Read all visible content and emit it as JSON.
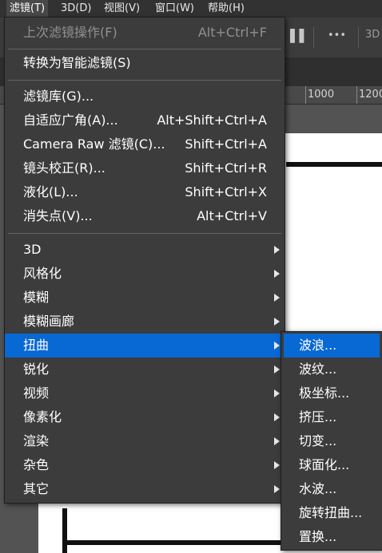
{
  "menubar": {
    "items": [
      {
        "label": "滤镜(T)",
        "active": true
      },
      {
        "label": "3D(D)"
      },
      {
        "label": "视图(V)"
      },
      {
        "label": "窗口(W)"
      },
      {
        "label": "帮助(H)"
      }
    ]
  },
  "options_bar": {
    "more_label": "•••",
    "label_3d": "3D"
  },
  "ruler": {
    "labels": [
      "1000",
      "1200"
    ]
  },
  "filter_menu": {
    "last_filter": {
      "label": "上次滤镜操作(F)",
      "shortcut": "Alt+Ctrl+F",
      "enabled": false
    },
    "convert_smart": {
      "label": "转换为智能滤镜(S)"
    },
    "gallery": {
      "label": "滤镜库(G)..."
    },
    "adaptive_wide": {
      "label": "自适应广角(A)...",
      "shortcut": "Alt+Shift+Ctrl+A"
    },
    "camera_raw": {
      "label": "Camera Raw 滤镜(C)...",
      "shortcut": "Shift+Ctrl+A"
    },
    "lens_correction": {
      "label": "镜头校正(R)...",
      "shortcut": "Shift+Ctrl+R"
    },
    "liquify": {
      "label": "液化(L)...",
      "shortcut": "Shift+Ctrl+X"
    },
    "vanishing_point": {
      "label": "消失点(V)...",
      "shortcut": "Alt+Ctrl+V"
    },
    "submenus": [
      {
        "label": "3D"
      },
      {
        "label": "风格化"
      },
      {
        "label": "模糊"
      },
      {
        "label": "模糊画廊"
      },
      {
        "label": "扭曲",
        "highlighted": true
      },
      {
        "label": "锐化"
      },
      {
        "label": "视频"
      },
      {
        "label": "像素化"
      },
      {
        "label": "渲染"
      },
      {
        "label": "杂色"
      },
      {
        "label": "其它"
      }
    ]
  },
  "distort_submenu": {
    "items": [
      {
        "label": "波浪...",
        "highlighted": true
      },
      {
        "label": "波纹..."
      },
      {
        "label": "极坐标..."
      },
      {
        "label": "挤压..."
      },
      {
        "label": "切变..."
      },
      {
        "label": "球面化..."
      },
      {
        "label": "水波..."
      },
      {
        "label": "旋转扭曲..."
      },
      {
        "label": "置换..."
      }
    ]
  },
  "colors": {
    "menu_bg": "#3c3c3c",
    "highlight": "#0868d4",
    "separator": "#646464",
    "disabled_text": "#909090",
    "app_bg": "#535353"
  }
}
